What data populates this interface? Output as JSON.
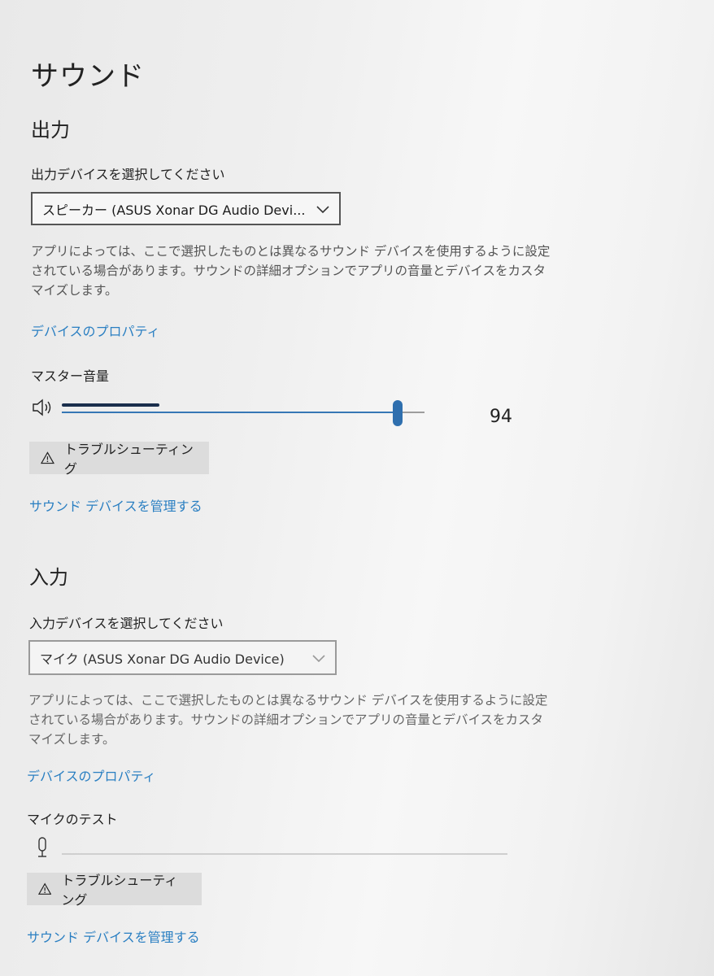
{
  "page": {
    "title": "サウンド"
  },
  "output": {
    "heading": "出力",
    "device_label": "出力デバイスを選択してください",
    "device_value": "スピーカー (ASUS Xonar DG Audio Devi...",
    "description": "アプリによっては、ここで選択したものとは異なるサウンド デバイスを使用するように設定されている場合があります。サウンドの詳細オプションでアプリの音量とデバイスをカスタマイズします。",
    "properties_link": "デバイスのプロパティ",
    "volume_label": "マスター音量",
    "volume_value": "94",
    "volume_level": 0.94,
    "troubleshoot_label": "トラブルシューティング",
    "manage_link": "サウンド デバイスを管理する"
  },
  "input": {
    "heading": "入力",
    "device_label": "入力デバイスを選択してください",
    "device_value": "マイク (ASUS Xonar DG Audio Device)",
    "description": "アプリによっては、ここで選択したものとは異なるサウンド デバイスを使用するように設定されている場合があります。サウンドの詳細オプションでアプリの音量とデバイスをカスタマイズします。",
    "properties_link": "デバイスのプロパティ",
    "mic_test_label": "マイクのテスト",
    "troubleshoot_label": "トラブルシューティング",
    "manage_link": "サウンド デバイスを管理する"
  },
  "icons": {
    "speaker": "speaker-icon",
    "microphone": "microphone-icon",
    "warning": "warning-icon",
    "chevron": "chevron-down-icon"
  },
  "colors": {
    "link": "#2a7fc2",
    "slider_accent": "#2f6fae",
    "button_bg": "#dcdcdc"
  }
}
